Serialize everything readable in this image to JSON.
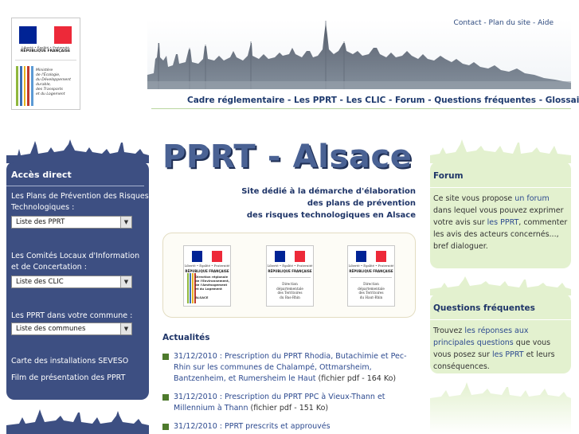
{
  "header": {
    "ministry": {
      "motto": "Liberté • Égalité • Fraternité",
      "republic": "RÉPUBLIQUE FRANÇAISE",
      "lines": [
        "Ministère",
        "de l'Écologie,",
        "du Développement",
        "durable,",
        "des Transports",
        "et du Logement"
      ]
    },
    "top_links": {
      "contact": "Contact",
      "sitemap": "Plan du site",
      "help": "Aide",
      "separator": " - "
    },
    "nav": [
      "Cadre réglementaire",
      "Les PPRT",
      "Les CLIC",
      "Forum",
      "Questions fréquentes",
      "Glossaire"
    ],
    "nav_separator": " - "
  },
  "left_sidebar": {
    "title": "Accès direct",
    "group1_label": "Les Plans de Prévention des Risques Technologiques :",
    "select1": "Liste des PPRT",
    "group2_label": "Les Comités Locaux d'Information et de Concertation :",
    "select2": "Liste des CLIC",
    "group3_label": "Les PPRT dans votre commune :",
    "select3": "Liste des communes",
    "link_seveso": "Carte des installations SEVESO",
    "link_film": "Film de présentation des PPRT"
  },
  "main": {
    "title": "PPRT - Alsace",
    "tagline": [
      "Site dédié à la démarche d'élaboration",
      "des plans de prévention",
      "des risques technologiques en Alsace"
    ],
    "partners": {
      "motto": "Liberté • Égalité • Fraternité",
      "republic": "RÉPUBLIQUE FRANÇAISE",
      "dreal_text": [
        "Direction régionale",
        "de l'Environnement,",
        "de l'Aménagement",
        "et du Logement"
      ],
      "dreal_name": "ALSACE",
      "ddt_bas": [
        "Direction",
        "départementale",
        "des Territoires",
        "du Bas-Rhin"
      ],
      "ddt_haut": [
        "Direction",
        "départementale",
        "des Territoires",
        "du Haut-Rhin"
      ]
    },
    "news_title": "Actualités",
    "news": [
      {
        "link": "31/12/2010 : Prescription du PPRT Rhodia, Butachimie et Pec-Rhin sur les communes de Chalampé, Ottmarsheim, Bantzenheim, et Rumersheim le Haut",
        "note": " (fichier pdf - 164 Ko)"
      },
      {
        "link": "31/12/2010 : Prescription du PPRT PPC à Vieux-Thann et Millennium à Thann",
        "note": " (fichier pdf - 151 Ko)"
      },
      {
        "link": "31/12/2010 : PPRT prescrits et approuvés",
        "note": ""
      }
    ]
  },
  "right_sidebar": {
    "forum": {
      "title": "Forum",
      "t1": "Ce site vous propose ",
      "l1": "un forum",
      "t2": " dans lequel vous pouvez exprimer votre avis sur ",
      "l2": "les PPRT",
      "t3": ", commenter les avis des acteurs concernés..., bref dialoguer."
    },
    "faq": {
      "title": "Questions fréquentes",
      "t1": "Trouvez ",
      "l1": "les réponses aux principales questions",
      "t2": " que vous vous posez sur ",
      "l2": "les PPRT",
      "t3": " et leurs conséquences."
    }
  },
  "colors": {
    "flag_blue": "#002395",
    "flag_white": "#ffffff",
    "flag_red": "#ed2939",
    "sidebar_blue": "#3d4f82",
    "sidebar_green": "#e3f1cf",
    "title_blue": "#4a6294",
    "bullet_green": "#4d7a2c"
  }
}
